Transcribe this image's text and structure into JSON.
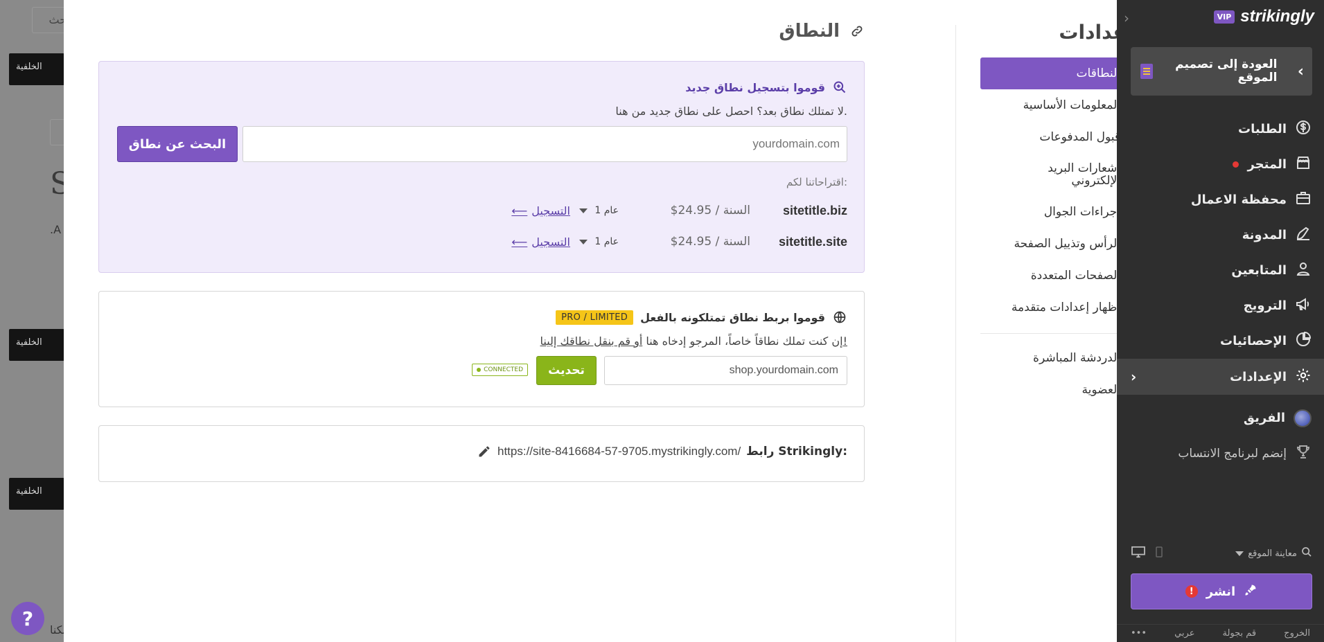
{
  "background": {
    "search_fragment": "بحث",
    "button_fragment": "الخلفية",
    "big_letter_1": "S",
    "small_text_1": ".A",
    "small_text_2": "بكنا."
  },
  "help": {
    "label": "?"
  },
  "settings_nav": {
    "title": "إعدادات",
    "items": [
      {
        "label": "النطاقات",
        "icon": "globe-icon",
        "active": true
      },
      {
        "label": "المعلومات الأساسية",
        "icon": "info-icon"
      },
      {
        "label": "قبول المدفوعات",
        "icon": "card-icon"
      },
      {
        "label": "اشعارات البريد الإلكتروني",
        "icon": "bell-icon"
      },
      {
        "label": "إجراءات الجوال",
        "icon": "mobile-icon"
      },
      {
        "label": "الرأس وتذييل الصفحة",
        "icon": "layout-icon"
      },
      {
        "label": "الصفحات المتعددة",
        "icon": "pages-icon"
      },
      {
        "label": "إظهار إعدادات متقدمة",
        "icon": "chevron-down-icon"
      }
    ],
    "extra_items": [
      {
        "label": "الدردشة المباشرة",
        "icon": "chat-icon"
      },
      {
        "label": "العضوية",
        "icon": "member-icon"
      }
    ]
  },
  "domain_section": {
    "title": "النطاق",
    "register": {
      "heading": "قوموا بتسجيل نطاق جديد",
      "subtitle": "لا تمتلك نطاق بعد؟ احصل على نطاق جديد من هنا.",
      "input_placeholder": "yourdomain.com",
      "search_button": "البحث عن نطاق",
      "suggestions_label": "اقتراحاتنا لكم:",
      "suggestions": [
        {
          "domain": "sitetitle.biz",
          "price": "$24.95 / السنة",
          "years": "1 عام",
          "action": "التسجيل"
        },
        {
          "domain": "sitetitle.site",
          "price": "$24.95 / السنة",
          "years": "1 عام",
          "action": "التسجيل"
        }
      ]
    },
    "connect": {
      "heading": "قوموا بربط نطاق تمتلكونه بالفعل",
      "badge": "PRO / LIMITED",
      "subtitle_prefix": "إن كنت تملك نطاقاً خاصاً، المرجو إدخاه هنا ",
      "subtitle_link": "أو قم بنقل نطاقك إلينا!",
      "input_value": "shop.yourdomain.com",
      "update_button": "تحديث",
      "status": "CONNECTED"
    },
    "strikingly_url": {
      "label": "رابط Strikingly:",
      "url": "https://site-8416684-57-9705.mystrikingly.com/"
    }
  },
  "sidebar": {
    "brand": "strikingly",
    "vip": "VIP",
    "back_label": "العودة إلى تصميم الموقع",
    "items": [
      {
        "label": "الطلبات",
        "icon": "dollar-icon"
      },
      {
        "label": "المتجر",
        "icon": "store-icon",
        "dot": true
      },
      {
        "label": "محفظة الاعمال",
        "icon": "briefcase-icon"
      },
      {
        "label": "المدونة",
        "icon": "pen-icon"
      },
      {
        "label": "المتابعين",
        "icon": "user-icon"
      },
      {
        "label": "الترويج",
        "icon": "megaphone-icon"
      },
      {
        "label": "الإحصائيات",
        "icon": "chart-icon"
      },
      {
        "label": "الإعدادات",
        "icon": "gear-icon",
        "active": true
      },
      {
        "label": "الفريق",
        "icon": "team-avatar"
      },
      {
        "label": "إنضم لبرنامج الانتساب",
        "icon": "trophy-icon"
      }
    ],
    "preview_label": "معاينة الموقع",
    "publish_label": "انشر",
    "footer": [
      "الخروج",
      "قم بجولة",
      "عربي",
      "•••"
    ]
  }
}
